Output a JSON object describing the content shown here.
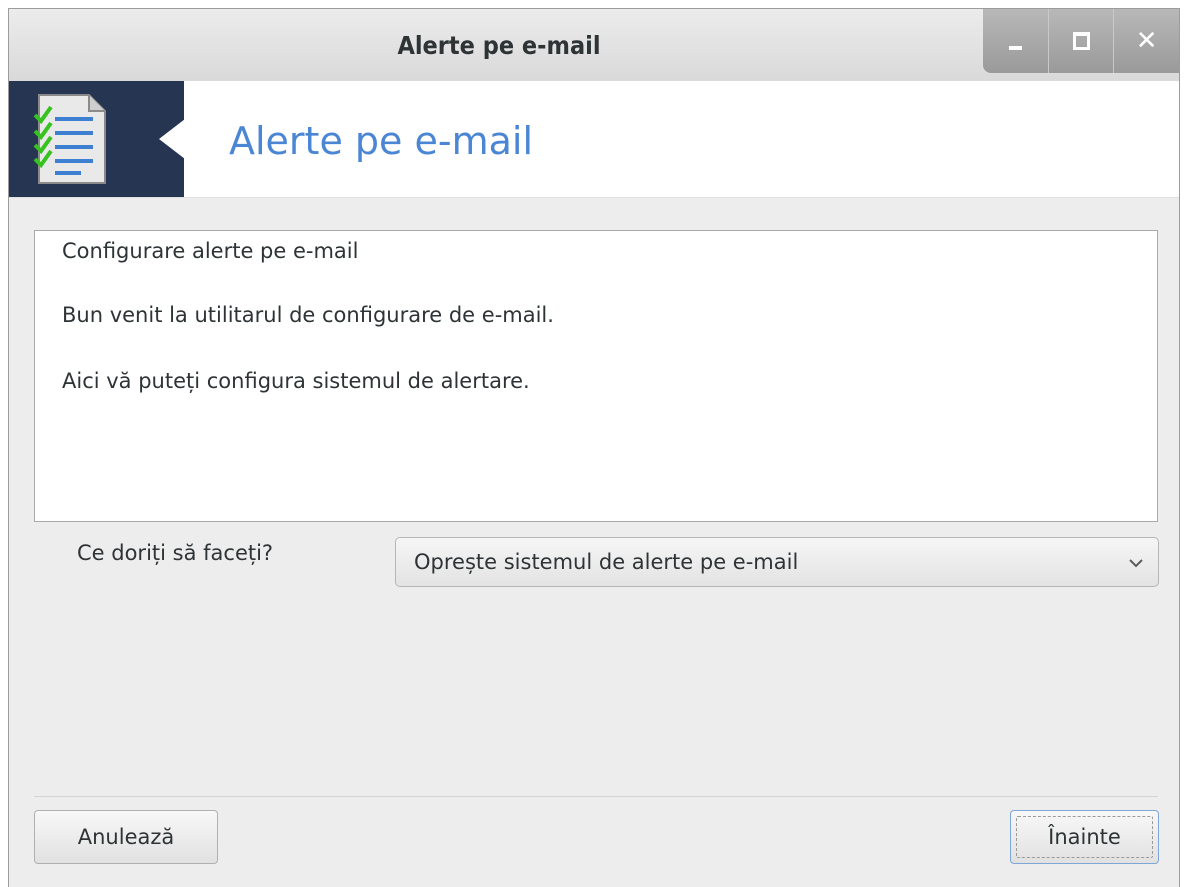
{
  "window": {
    "title": "Alerte pe e-mail",
    "controls": {
      "minimize": "_",
      "maximize": "□",
      "close": "✕"
    }
  },
  "banner": {
    "title": "Alerte pe e-mail",
    "icon": "document-checklist-icon"
  },
  "intro": {
    "heading": "Configurare alerte pe e-mail",
    "welcome": "Bun venit la utilitarul de configurare de e-mail.",
    "description": "Aici vă puteți configura sistemul de alertare."
  },
  "action": {
    "label": "Ce doriți să faceți?",
    "selected": "Oprește sistemul de alerte pe e-mail"
  },
  "buttons": {
    "cancel": "Anulează",
    "next": "Înainte"
  },
  "colors": {
    "banner_bg": "#263552",
    "accent_title": "#4a86d4"
  }
}
